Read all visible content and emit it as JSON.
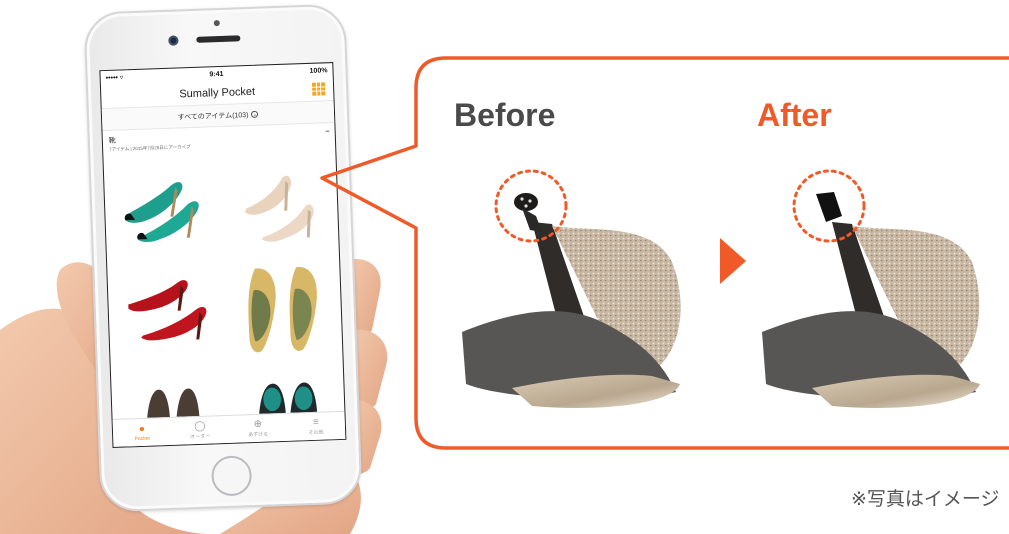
{
  "phone_app": {
    "status": {
      "carrier": "••••• ▿",
      "time": "9:41",
      "battery": "100%"
    },
    "title": "Sumally Pocket",
    "filter_label": "すべてのアイテム(103)",
    "section": {
      "title": "靴",
      "subtitle": "7アイテム | 2015年7月28日にアーカイブ"
    },
    "tabs": [
      {
        "label": "Pocket",
        "icon": "pocket-icon",
        "active": true
      },
      {
        "label": "オーダー",
        "icon": "check-circle-icon",
        "active": false
      },
      {
        "label": "あずける",
        "icon": "plus-circle-icon",
        "active": false
      },
      {
        "label": "その他",
        "icon": "menu-icon",
        "active": false
      }
    ],
    "accent_color": "#f5a623"
  },
  "comparison": {
    "before_label": "Before",
    "after_label": "After",
    "arrow_color": "#f05a28",
    "frame_color": "#f05a28",
    "before_color": "#4a4a4a"
  },
  "note": "※写真はイメージ"
}
